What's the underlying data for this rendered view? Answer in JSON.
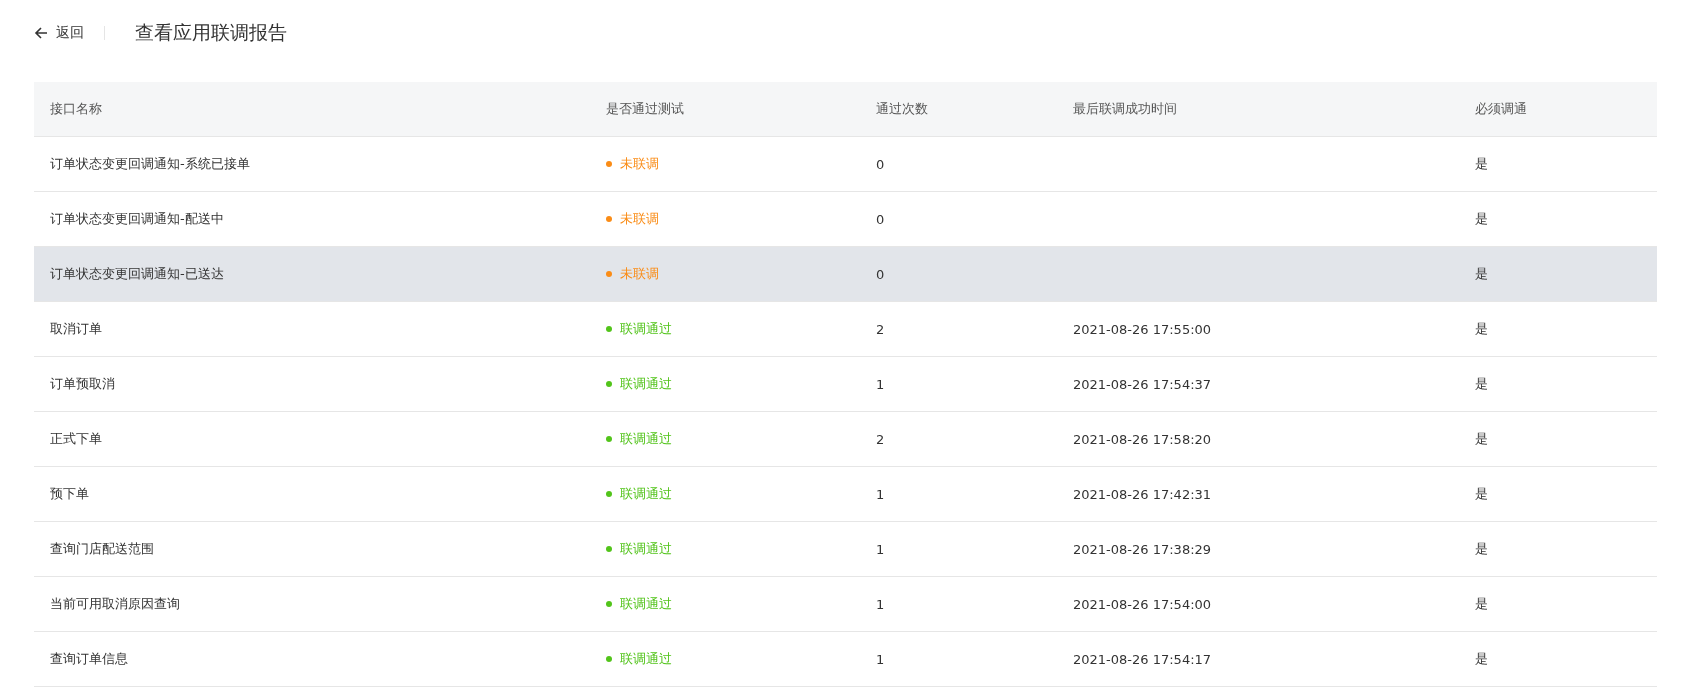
{
  "header": {
    "back_label": "返回",
    "title": "查看应用联调报告"
  },
  "table": {
    "columns": [
      "接口名称",
      "是否通过测试",
      "通过次数",
      "最后联调成功时间",
      "必须调通"
    ],
    "rows": [
      {
        "name": "订单状态变更回调通知-系统已接单",
        "status": "未联调",
        "color": "#fa8c16",
        "count": "0",
        "required": "是",
        "selected": false
      },
      {
        "name": "订单状态变更回调通知-配送中",
        "status": "未联调",
        "color": "#fa8c16",
        "count": "0",
        "required": "是",
        "selected": false
      },
      {
        "name": "订单状态变更回调通知-已送达",
        "status": "未联调",
        "color": "#fa8c16",
        "count": "0",
        "required": "是",
        "selected": true
      },
      {
        "name": "取消订单",
        "status": "联调通过",
        "color": "#52c41a",
        "count": "2",
        "time": "2021-08-26 17:55:00",
        "required": "是",
        "selected": false
      },
      {
        "name": "订单预取消",
        "status": "联调通过",
        "color": "#52c41a",
        "count": "1",
        "time": "2021-08-26 17:54:37",
        "required": "是",
        "selected": false
      },
      {
        "name": "正式下单",
        "status": "联调通过",
        "color": "#52c41a",
        "count": "2",
        "time": "2021-08-26 17:58:20",
        "required": "是",
        "selected": false
      },
      {
        "name": "预下单",
        "status": "联调通过",
        "color": "#52c41a",
        "count": "1",
        "time": "2021-08-26 17:42:31",
        "required": "是",
        "selected": false
      },
      {
        "name": "查询门店配送范围",
        "status": "联调通过",
        "color": "#52c41a",
        "count": "1",
        "time": "2021-08-26 17:38:29",
        "required": "是",
        "selected": false
      },
      {
        "name": "当前可用取消原因查询",
        "status": "联调通过",
        "color": "#52c41a",
        "count": "1",
        "time": "2021-08-26 17:54:00",
        "required": "是",
        "selected": false
      },
      {
        "name": "查询订单信息",
        "status": "联调通过",
        "color": "#52c41a",
        "count": "1",
        "time": "2021-08-26 17:54:17",
        "required": "是",
        "selected": false
      }
    ]
  }
}
